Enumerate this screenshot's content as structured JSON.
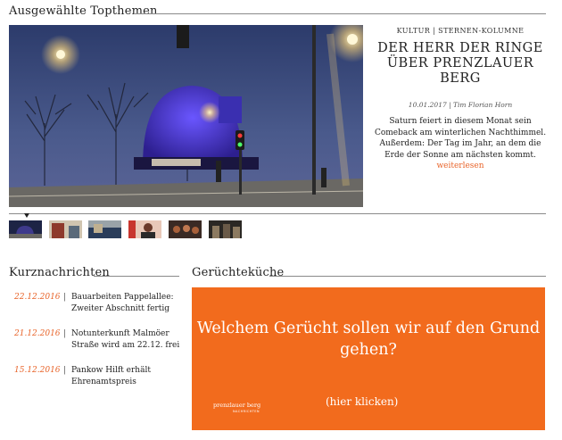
{
  "topthemen": {
    "section_title": "Ausgewählte Topthemen",
    "kicker": "KULTUR | STERNEN-KOLUMNE",
    "headline": "DER HERR DER RINGE ÜBER PRENZLAUER BERG",
    "byline": "10.01.2017 | Tim Florian Horn",
    "teaser": "Saturn feiert in diesem Monat sein Comeback am winterlichen Nachthimmel. Außerdem: Der Tag im Jahr, an dem die Erde der Sonne am nächsten kommt.",
    "more_label": "weiterlesen",
    "thumbnails": [
      {
        "name": "thumb-1",
        "colors": [
          "#1d2445",
          "#3e3a8c"
        ]
      },
      {
        "name": "thumb-2",
        "colors": [
          "#8e3a2c",
          "#d0c5b0"
        ]
      },
      {
        "name": "thumb-3",
        "colors": [
          "#2a3d5a",
          "#9aa3a8"
        ]
      },
      {
        "name": "thumb-4",
        "colors": [
          "#c8352e",
          "#e8c8b8"
        ]
      },
      {
        "name": "thumb-5",
        "colors": [
          "#3a2a24",
          "#a8603a"
        ]
      },
      {
        "name": "thumb-6",
        "colors": [
          "#2b2824",
          "#8c7a60"
        ]
      }
    ]
  },
  "kurznachrichten": {
    "section_title": "Kurznachrichten",
    "items": [
      {
        "date": "22.12.2016",
        "text": "Bauarbeiten Pappelallee: Zweiter Abschnitt fertig"
      },
      {
        "date": "21.12.2016",
        "text": "Notunterkunft Malmöer Straße wird am 22.12. frei"
      },
      {
        "date": "15.12.2016",
        "text": "Pankow Hilft erhält Ehrenamtspreis"
      }
    ]
  },
  "geruechtekueche": {
    "section_title": "Gerüchteküche",
    "question": "Welchem Gerücht sollen wir auf den Grund gehen?",
    "click_label": "(hier klicken)",
    "logo_text": "prenzlauer berg",
    "logo_sub": "NACHRICHTEN"
  },
  "colors": {
    "accent": "#e8642a",
    "box_orange": "#f26b1d",
    "rule": "#8a8a8a"
  }
}
